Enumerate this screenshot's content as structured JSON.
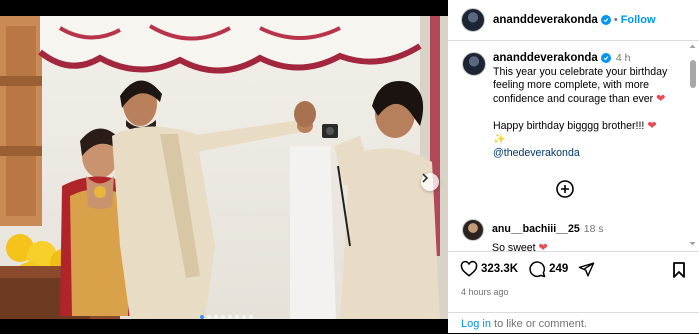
{
  "post": {
    "username": "ananddeverakonda",
    "follow_label": "Follow",
    "caption_time": "4 h",
    "caption_text": "This year you celebrate your birthday feeling more complete, with more confidence and courage than ever",
    "caption_line2": "Happy birthday bigggg brother!!!",
    "mention": "@thedeverakonda",
    "likes": "323.3K",
    "comments": "249",
    "posted_ago": "4 hours ago",
    "carousel_total": 8,
    "carousel_index": 1
  },
  "comment": {
    "username": "anu__bachiii__25",
    "time": "18 s",
    "text": "So sweet"
  },
  "footer": {
    "login_label": "Log in",
    "login_suffix": "to like or comment."
  },
  "icons": {
    "verified": "verified-badge-icon",
    "add_comment": "plus-circle-icon",
    "like": "heart-icon",
    "comment": "comment-bubble-icon",
    "share": "paper-plane-icon",
    "save": "bookmark-icon",
    "next": "chevron-right-icon"
  },
  "colors": {
    "accent": "#0095f6",
    "heart": "#ed4956",
    "muted": "#737373"
  }
}
